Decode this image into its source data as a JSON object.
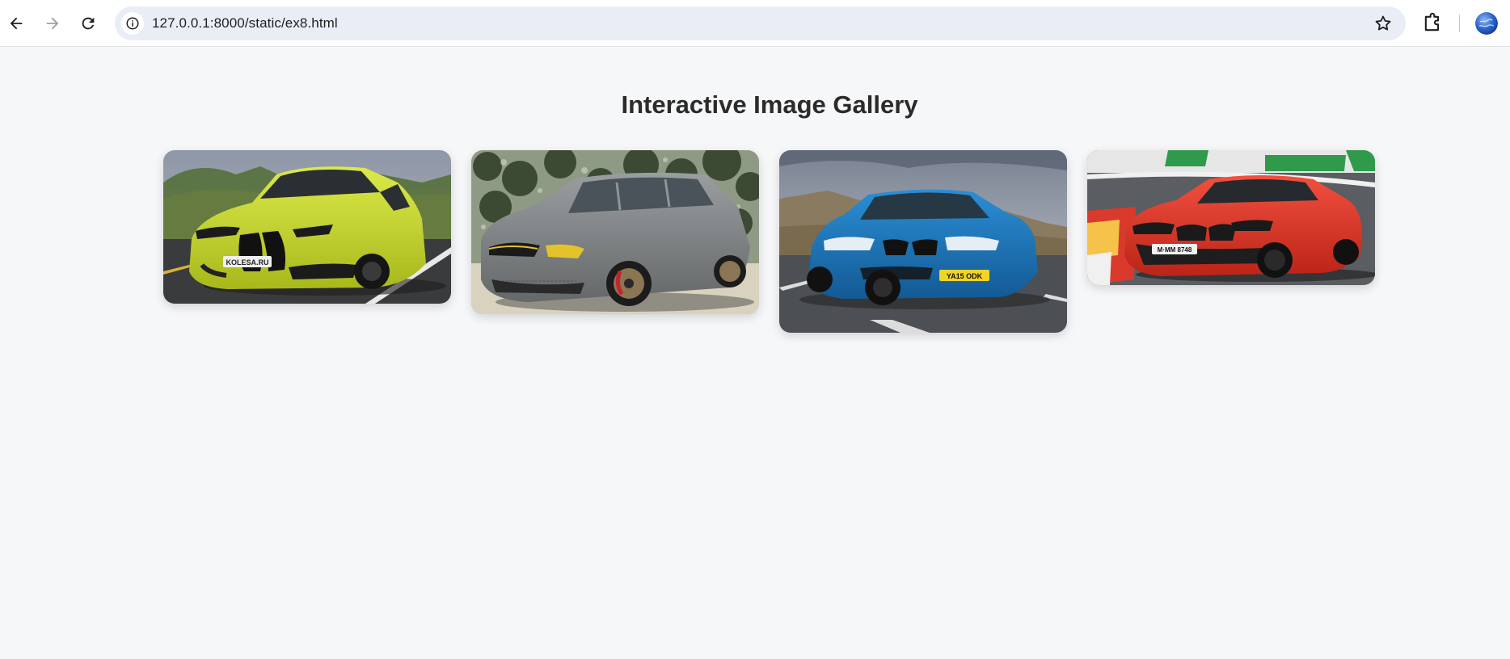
{
  "browser": {
    "url": "127.0.0.1:8000/static/ex8.html",
    "icons": [
      "back-arrow-icon",
      "forward-arrow-icon",
      "reload-icon",
      "site-info-icon",
      "bookmark-star-icon",
      "extensions-icon",
      "profile-avatar"
    ]
  },
  "page": {
    "title": "Interactive Image Gallery"
  },
  "gallery": {
    "images": [
      {
        "color": "#c6d82a",
        "plate": "KOLESA.RU"
      },
      {
        "color": "#7b7f82"
      },
      {
        "color": "#1f7fc2",
        "plate": "YA15 ODK"
      },
      {
        "color": "#e8392d",
        "plate": "M·MM 8748"
      }
    ]
  }
}
